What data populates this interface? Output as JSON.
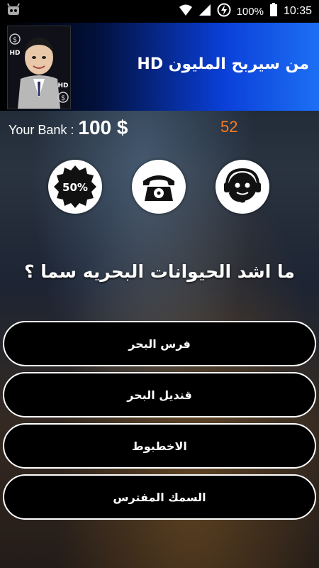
{
  "status_bar": {
    "battery": "100%",
    "time": "10:35"
  },
  "header": {
    "app_title": "من سيربح المليون HD",
    "logo_badges": [
      "HD",
      "HD"
    ]
  },
  "bank": {
    "label": "Your Bank :",
    "amount": "100 $"
  },
  "timer": "52",
  "lifelines": [
    {
      "name": "fifty-fifty",
      "label": "50%"
    },
    {
      "name": "phone-a-friend",
      "label": ""
    },
    {
      "name": "ask-audience",
      "label": ""
    }
  ],
  "question": "ما اشد الحيوانات البحريه سما ؟",
  "answers": [
    "فرس البحر",
    "قنديل البحر",
    "الاخطبوط",
    "السمك المفترس"
  ],
  "colors": {
    "timer": "#ff7a1a",
    "header_accent": "#1d6ff5"
  }
}
